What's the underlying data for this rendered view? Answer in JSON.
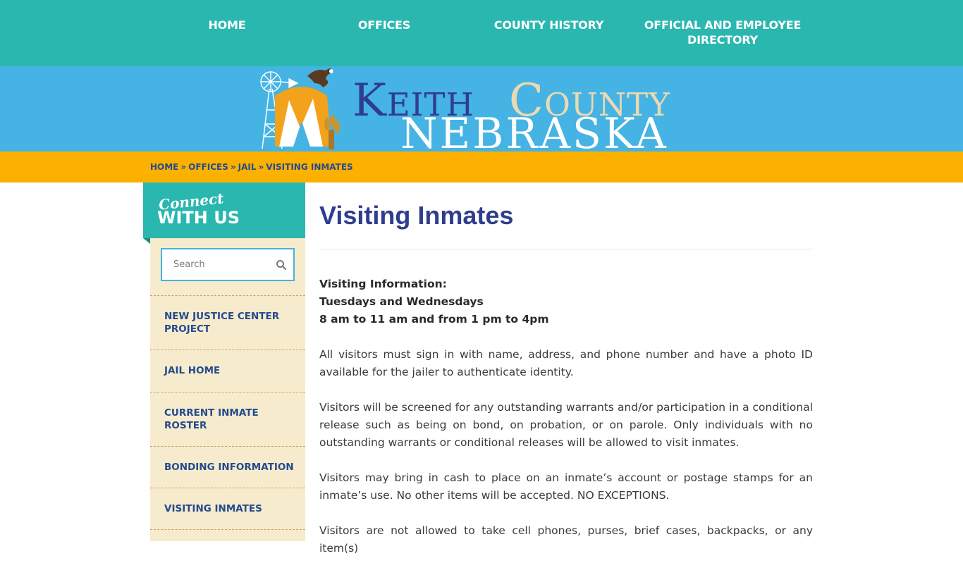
{
  "nav": {
    "home": "HOME",
    "offices": "OFFICES",
    "county_history": "COUNTY HISTORY",
    "directory": "OFFICIAL AND EMPLOYEE DIRECTORY"
  },
  "logo": {
    "keith": "Keith",
    "county": "County",
    "state": "NEBRASKA"
  },
  "breadcrumb": {
    "home": "HOME",
    "offices": "OFFICES",
    "jail": "JAIL",
    "current": "VISITING INMATES",
    "separator": "»"
  },
  "sidebar": {
    "connect_script": "Connect",
    "connect_title": "WITH US",
    "search_placeholder": "Search",
    "links": [
      "NEW JUSTICE CENTER PROJECT",
      "JAIL HOME",
      "CURRENT INMATE ROSTER",
      "BONDING INFORMATION",
      "VISITING INMATES"
    ]
  },
  "main": {
    "title": "Visiting Inmates",
    "info_heading": "Visiting Information:",
    "info_days": "Tuesdays and Wednesdays",
    "info_hours": "8 am to 11 am and from 1 pm to 4pm",
    "para1": "All visitors must sign in with name, address, and phone number and have a photo ID available for the jailer to authenticate identity.",
    "para2": "Visitors will be screened for any outstanding warrants and/or participation in a conditional release such as being on bond, on probation, or on parole.  Only individuals with no outstanding warrants or conditional releases will be allowed to visit inmates.",
    "para3": "Visitors may bring in cash to place on an inmate’s account or postage stamps for an inmate’s use.  No other items will be accepted.  NO EXCEPTIONS.",
    "para4": "Visitors are not allowed to take cell phones, purses, brief cases, backpacks, or any item(s)"
  },
  "colors": {
    "teal": "#2ab7b0",
    "sky": "#45b3e3",
    "gold": "#fcb100",
    "navy": "#2f3d8f",
    "cream": "#f6ebcc"
  }
}
